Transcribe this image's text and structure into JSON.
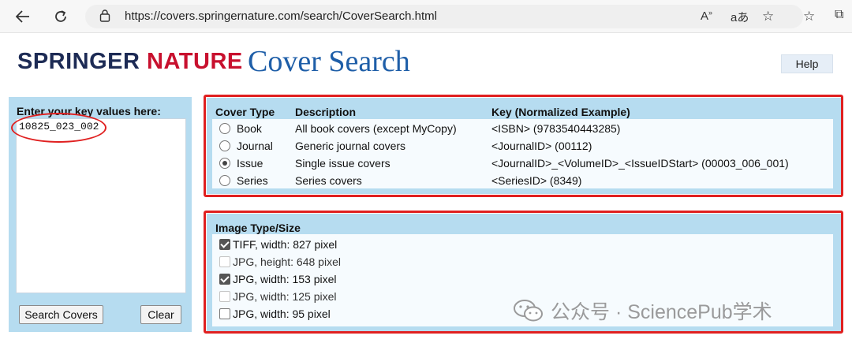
{
  "browser": {
    "url": "https://covers.springernature.com/search/CoverSearch.html"
  },
  "header": {
    "logo_part1": "SPRINGER",
    "logo_part2": "NATURE",
    "title": "Cover Search",
    "help_label": "Help"
  },
  "key_panel": {
    "label": "Enter your key values here:",
    "value": "10825_023_002",
    "search_label": "Search Covers",
    "clear_label": "Clear"
  },
  "cover_panel": {
    "headers": [
      "Cover Type",
      "Description",
      "Key (Normalized Example)"
    ],
    "rows": [
      {
        "type": "Book",
        "description": "All book covers (except MyCopy)",
        "key": "<ISBN> (9783540443285)",
        "selected": false
      },
      {
        "type": "Journal",
        "description": "Generic journal covers",
        "key": "<JournalID> (00112)",
        "selected": false
      },
      {
        "type": "Issue",
        "description": "Single issue covers",
        "key": "<JournalID>_<VolumeID>_<IssueIDStart> (00003_006_001)",
        "selected": true
      },
      {
        "type": "Series",
        "description": "Series covers",
        "key": "<SeriesID> (8349)",
        "selected": false
      }
    ]
  },
  "image_panel": {
    "header": "Image Type/Size",
    "options": [
      {
        "label": "TIFF, width: 827 pixel",
        "checked": true,
        "enabled": true
      },
      {
        "label": "JPG, height: 648 pixel",
        "checked": false,
        "enabled": false
      },
      {
        "label": "JPG, width: 153 pixel",
        "checked": true,
        "enabled": true
      },
      {
        "label": "JPG, width: 125 pixel",
        "checked": false,
        "enabled": false
      },
      {
        "label": "JPG, width: 95 pixel",
        "checked": false,
        "enabled": true
      }
    ]
  },
  "watermark": {
    "text": "公众号 · SciencePub学术"
  },
  "colors": {
    "panel_bg": "#b6dcf0",
    "annotation_red": "#e02020",
    "title_blue": "#1e5ea8",
    "brand_navy": "#1d2b55",
    "brand_red": "#c8102e"
  }
}
